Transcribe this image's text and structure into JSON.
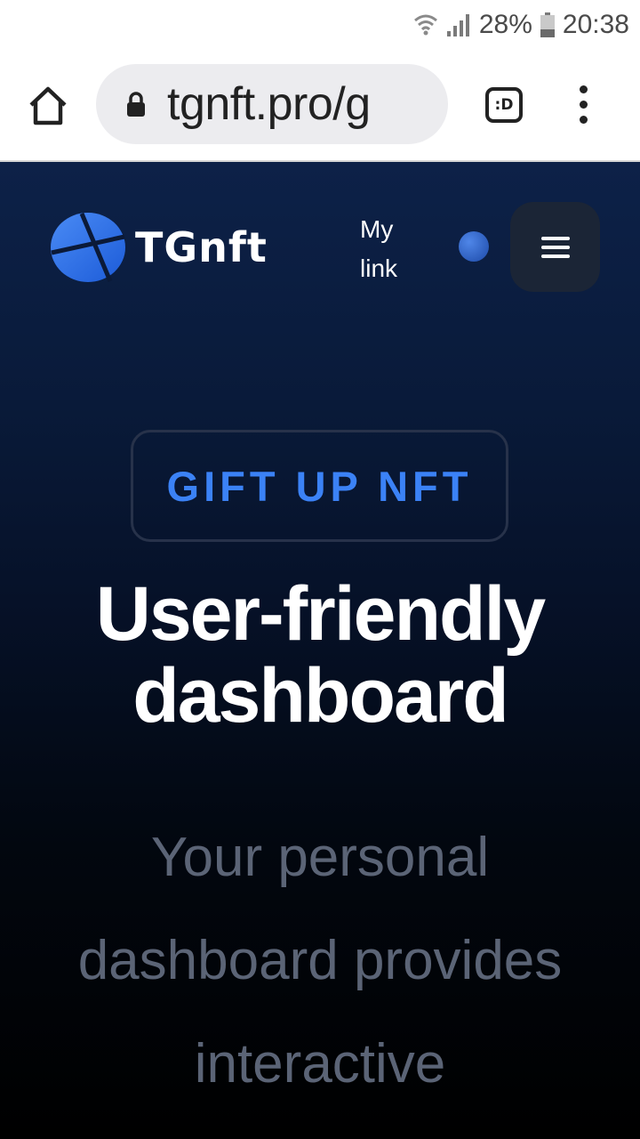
{
  "status_bar": {
    "battery": "28%",
    "time": "20:38"
  },
  "browser": {
    "url": "tgnft.pro/g",
    "tab_label": ":D"
  },
  "header": {
    "logo_text": "TGnft",
    "my_link": "My link"
  },
  "hero": {
    "badge": "GIFT UP NFT",
    "headline_line1": "User-friendly",
    "headline_line2": "dashboard",
    "subtext": "Your personal dashboard provides interactive"
  },
  "colors": {
    "accent": "#3b82f6",
    "page_top": "#0d2148",
    "page_bottom": "#000000",
    "subtext": "#5b6476"
  }
}
